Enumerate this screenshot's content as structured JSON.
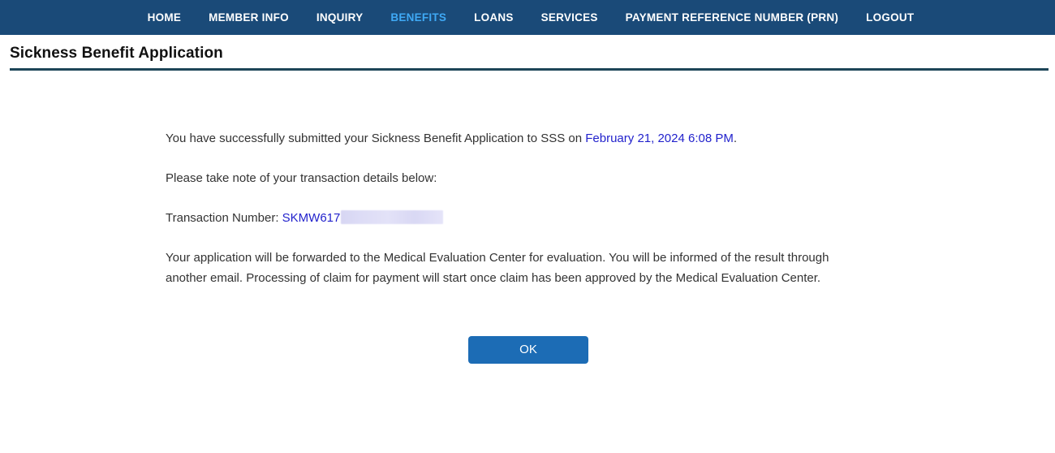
{
  "nav": {
    "background_color": "#1a4a78",
    "active_color": "#3fa9f5",
    "items": [
      {
        "label": "HOME",
        "active": false
      },
      {
        "label": "MEMBER INFO",
        "active": false
      },
      {
        "label": "INQUIRY",
        "active": false
      },
      {
        "label": "BENEFITS",
        "active": true
      },
      {
        "label": "LOANS",
        "active": false
      },
      {
        "label": "SERVICES",
        "active": false
      },
      {
        "label": "PAYMENT REFERENCE NUMBER (PRN)",
        "active": false
      },
      {
        "label": "LOGOUT",
        "active": false
      }
    ]
  },
  "header": {
    "title": "Sickness Benefit Application",
    "rule_color": "#1d4558"
  },
  "main": {
    "confirmation": {
      "prefix": "You have successfully submitted your Sickness Benefit Application to SSS on ",
      "date": "February 21, 2024 6:08 PM",
      "suffix": ".",
      "date_color": "#2222cc"
    },
    "note_line": "Please take note of your transaction details below:",
    "transaction": {
      "label": "Transaction Number: ",
      "value": "SKMW617",
      "value_color": "#2222cc",
      "redacted_suffix": true
    },
    "forwarding_notice": "Your application will be forwarded to the Medical Evaluation Center for evaluation. You will be informed of the result through another email. Processing of claim for payment will start once claim has been approved by the Medical Evaluation Center."
  },
  "footer": {
    "ok_button": {
      "label": "OK",
      "background_color": "#1c6cb5",
      "text_color": "#ffffff"
    }
  }
}
